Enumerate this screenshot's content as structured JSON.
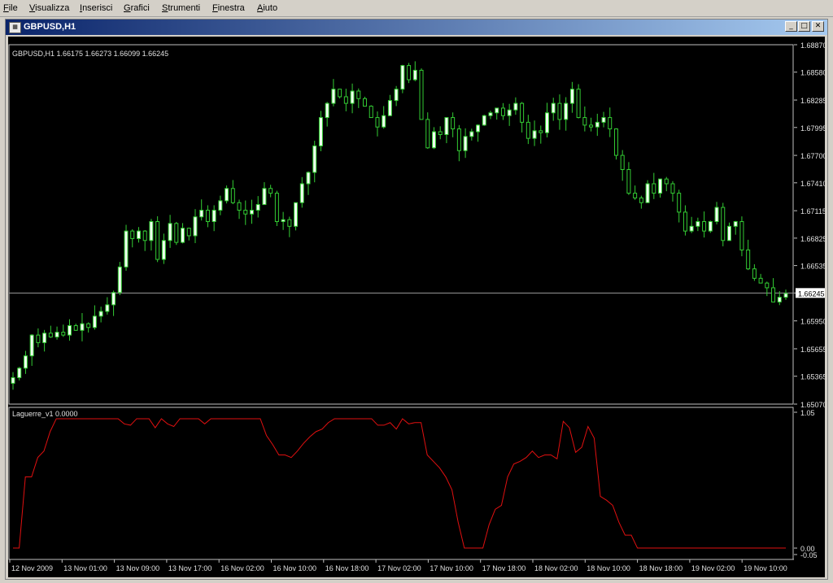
{
  "menu": [
    "File",
    "Visualizza",
    "Inserisci",
    "Grafici",
    "Strumenti",
    "Finestra",
    "Aiuto"
  ],
  "window": {
    "title": "GBPUSD,H1",
    "icon": "chart-window-icon"
  },
  "colors": {
    "bull": "#f0fff0",
    "bear": "#000000",
    "wick": "#33cc33",
    "osc": "#e01010",
    "axis": "#c0c0c0",
    "text": "#e0e0e0",
    "bid_line": "#9a9a9a"
  },
  "chart_data": [
    {
      "type": "candlestick",
      "title": "GBPUSD,H1  1.66175 1.66273 1.66099 1.66245",
      "ylim": [
        1.6507,
        1.6887
      ],
      "yticks": [
        "1.68870",
        "1.68580",
        "1.68285",
        "1.67995",
        "1.67700",
        "1.67410",
        "1.67115",
        "1.66825",
        "1.66535",
        "1.66245",
        "1.65950",
        "1.65655",
        "1.65365",
        "1.65070"
      ],
      "current_price": "1.66245",
      "xticks": [
        "12 Nov 2009",
        "13 Nov 01:00",
        "13 Nov 09:00",
        "13 Nov 17:00",
        "16 Nov 02:00",
        "16 Nov 10:00",
        "16 Nov 18:00",
        "17 Nov 02:00",
        "17 Nov 10:00",
        "17 Nov 18:00",
        "18 Nov 02:00",
        "18 Nov 10:00",
        "18 Nov 18:00",
        "19 Nov 02:00",
        "19 Nov 10:00"
      ],
      "closes": [
        1.6535,
        1.6545,
        1.6558,
        1.658,
        1.6572,
        1.6582,
        1.6578,
        1.6583,
        1.658,
        1.659,
        1.6585,
        1.6592,
        1.6588,
        1.66,
        1.6605,
        1.6612,
        1.6625,
        1.6652,
        1.669,
        1.6682,
        1.669,
        1.668,
        1.67,
        1.666,
        1.668,
        1.6698,
        1.6678,
        1.6693,
        1.6685,
        1.6705,
        1.6712,
        1.67,
        1.6712,
        1.6722,
        1.6735,
        1.672,
        1.6712,
        1.6708,
        1.6712,
        1.6718,
        1.6735,
        1.673,
        1.67,
        1.6702,
        1.6695,
        1.672,
        1.674,
        1.6752,
        1.678,
        1.681,
        1.6825,
        1.684,
        1.6832,
        1.6825,
        1.6838,
        1.683,
        1.6822,
        1.681,
        1.68,
        1.6812,
        1.6828,
        1.684,
        1.6865,
        1.685,
        1.686,
        1.6808,
        1.6778,
        1.6795,
        1.6792,
        1.681,
        1.6798,
        1.6775,
        1.679,
        1.6795,
        1.6802,
        1.6812,
        1.6815,
        1.682,
        1.6812,
        1.6818,
        1.6825,
        1.6805,
        1.6788,
        1.6796,
        1.6794,
        1.6815,
        1.6825,
        1.6808,
        1.6825,
        1.684,
        1.681,
        1.6802,
        1.68,
        1.6805,
        1.681,
        1.6798,
        1.677,
        1.6755,
        1.673,
        1.6725,
        1.672,
        1.674,
        1.673,
        1.6745,
        1.674,
        1.673,
        1.671,
        1.669,
        1.6695,
        1.67,
        1.669,
        1.67,
        1.6715,
        1.668,
        1.6695,
        1.67,
        1.667,
        1.665,
        1.664,
        1.6635,
        1.663,
        1.6615,
        1.662,
        1.6624
      ],
      "volatility": 0.0012
    },
    {
      "type": "line",
      "title": "Laguerre_v1 0.0000",
      "ylim": [
        -0.05,
        1.05
      ],
      "yticks": [
        "1.05",
        "0.00",
        "-0.05"
      ],
      "series": [
        {
          "values": [
            0.0,
            0.0,
            0.55,
            0.55,
            0.7,
            0.75,
            0.9,
            1.0,
            1.0,
            1.0,
            1.0,
            1.0,
            1.0,
            1.0,
            1.0,
            1.0,
            1.0,
            1.0,
            0.96,
            0.95,
            1.0,
            1.0,
            1.0,
            0.93,
            1.0,
            0.96,
            0.94,
            1.0,
            1.0,
            1.0,
            1.0,
            0.96,
            1.0,
            1.0,
            1.0,
            1.0,
            1.0,
            1.0,
            1.0,
            1.0,
            1.0,
            0.87,
            0.8,
            0.72,
            0.72,
            0.7,
            0.75,
            0.81,
            0.86,
            0.9,
            0.92,
            0.97,
            1.0,
            1.0,
            1.0,
            1.0,
            1.0,
            1.0,
            1.0,
            0.95,
            0.95,
            0.97,
            0.92,
            1.0,
            0.96,
            0.97,
            0.97,
            0.72,
            0.67,
            0.62,
            0.55,
            0.45,
            0.2,
            0.0,
            0.0,
            0.0,
            0.0,
            0.18,
            0.3,
            0.33,
            0.55,
            0.65,
            0.67,
            0.7,
            0.75,
            0.7,
            0.72,
            0.72,
            0.69,
            0.98,
            0.93,
            0.74,
            0.78,
            0.94,
            0.85,
            0.4,
            0.37,
            0.33,
            0.2,
            0.1,
            0.1,
            0.0,
            0.0,
            0.0,
            0.0,
            0.0,
            0.0,
            0.0,
            0.0,
            0.0,
            0.0,
            0.0,
            0.0,
            0.0,
            0.0,
            0.0,
            0.0,
            0.0,
            0.0,
            0.0,
            0.0,
            0.0,
            0.0,
            0.0,
            0.0,
            0.0
          ]
        }
      ]
    }
  ]
}
